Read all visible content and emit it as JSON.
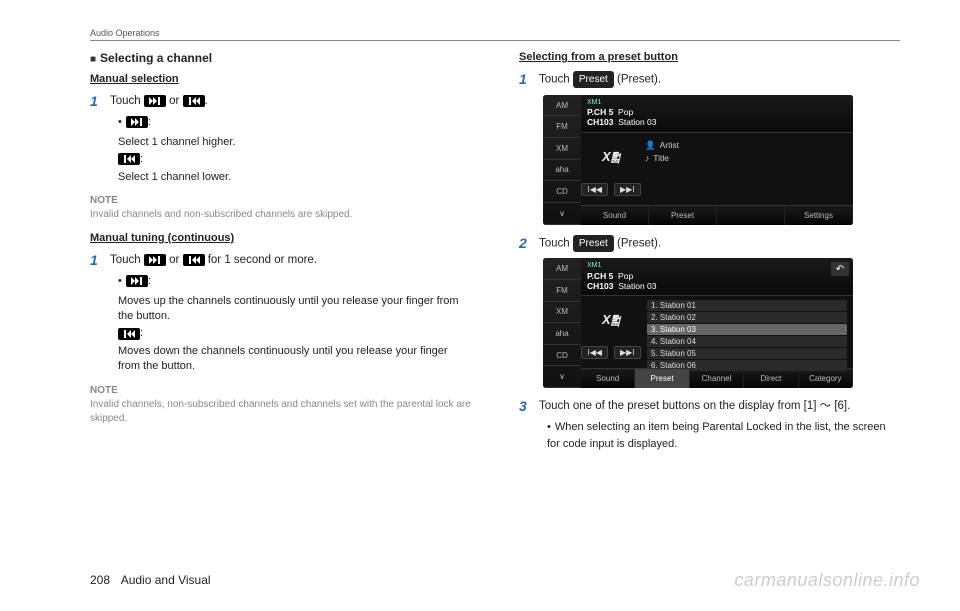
{
  "header": {
    "section": "Audio Operations"
  },
  "left": {
    "title": "Selecting a channel",
    "sub1": "Manual selection",
    "step1": {
      "num": "1",
      "text_a": "Touch ",
      "text_b": " or ",
      "text_c": "."
    },
    "b1": {
      "higher": "Select 1 channel higher.",
      "lower": "Select 1 channel lower."
    },
    "note1": {
      "label": "NOTE",
      "text": "Invalid channels and non-subscribed channels are skipped."
    },
    "sub2": "Manual tuning (continuous)",
    "step2": {
      "num": "1",
      "text_a": "Touch ",
      "text_b": " or ",
      "text_c": " for 1 second or more."
    },
    "b2": {
      "up": "Moves up the channels continuously until you release your finger from the button.",
      "down": "Moves down the channels continuously until you release your finger from the button."
    },
    "note2": {
      "label": "NOTE",
      "text": "Invalid channels, non-subscribed channels and channels set with the parental lock are skipped."
    }
  },
  "right": {
    "title": "Selecting from a preset button",
    "step1": {
      "num": "1",
      "text_a": "Touch ",
      "pill": "Preset",
      "text_b": " (Preset)."
    },
    "step2": {
      "num": "2",
      "text_a": "Touch ",
      "pill": "Preset",
      "text_b": " (Preset)."
    },
    "step3": {
      "num": "3",
      "text": "Touch one of the preset buttons on the display from [1]  ～  [6]."
    },
    "bullet3": "When selecting an item being Parental Locked in the list, the screen for code input is displayed."
  },
  "screens": {
    "left_tabs": [
      "AM",
      "FM",
      "XM",
      "aha",
      "CD",
      "∨"
    ],
    "top": {
      "band": "XM1",
      "pch": "P.CH 5",
      "ch": "CH103",
      "cat": "Pop",
      "name": "Station 03"
    },
    "info": {
      "artist_label": "Artist",
      "title_label": "Title"
    },
    "seek_prev": "I◀◀",
    "seek_next": "▶▶I",
    "bottom1": [
      "Sound",
      "Preset",
      "",
      "Settings"
    ],
    "list": [
      "1. Station 01",
      "2. Station 02",
      "3. Station 03",
      "4. Station 04",
      "5. Station 05",
      "6. Station 06"
    ],
    "bottom2": [
      "Sound",
      "Preset",
      "Channel",
      "Direct",
      "Category"
    ]
  },
  "footer": {
    "page": "208",
    "chapter": "Audio and Visual"
  },
  "watermark": "carmanualsonline.info"
}
